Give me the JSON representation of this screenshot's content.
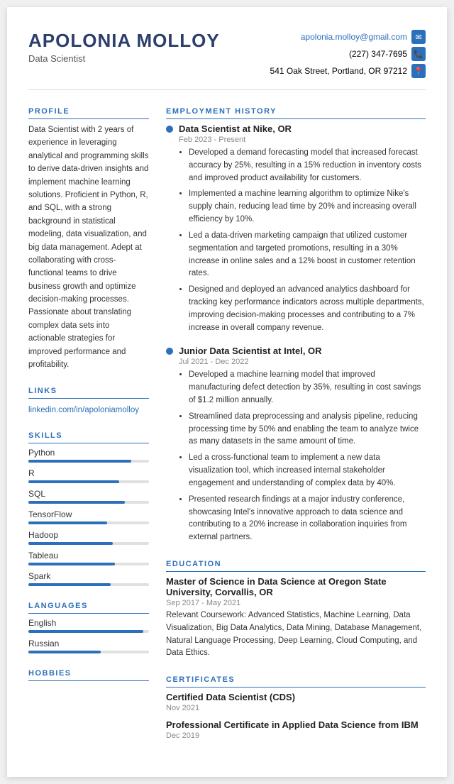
{
  "header": {
    "name": "APOLONIA MOLLOY",
    "title": "Data Scientist",
    "email": "apolonia.molloy@gmail.com",
    "phone": "(227) 347-7695",
    "address": "541 Oak Street, Portland, OR 97212"
  },
  "left": {
    "profile_title": "PROFILE",
    "profile_text": "Data Scientist with 2 years of experience in leveraging analytical and programming skills to derive data-driven insights and implement machine learning solutions. Proficient in Python, R, and SQL, with a strong background in statistical modeling, data visualization, and big data management. Adept at collaborating with cross-functional teams to drive business growth and optimize decision-making processes. Passionate about translating complex data sets into actionable strategies for improved performance and profitability.",
    "links_title": "LINKS",
    "linkedin": "linkedin.com/in/apoloniamolloy",
    "linkedin_href": "https://linkedin.com/in/apoloniamolloy",
    "skills_title": "SKILLS",
    "skills": [
      {
        "name": "Python",
        "pct": 85
      },
      {
        "name": "R",
        "pct": 75
      },
      {
        "name": "SQL",
        "pct": 80
      },
      {
        "name": "TensorFlow",
        "pct": 65
      },
      {
        "name": "Hadoop",
        "pct": 70
      },
      {
        "name": "Tableau",
        "pct": 72
      },
      {
        "name": "Spark",
        "pct": 68
      }
    ],
    "languages_title": "LANGUAGES",
    "languages": [
      {
        "name": "English",
        "pct": 95
      },
      {
        "name": "Russian",
        "pct": 60
      }
    ],
    "hobbies_title": "HOBBIES"
  },
  "right": {
    "employment_title": "EMPLOYMENT HISTORY",
    "jobs": [
      {
        "title": "Data Scientist at Nike, OR",
        "dates": "Feb 2023 - Present",
        "bullets": [
          "Developed a demand forecasting model that increased forecast accuracy by 25%, resulting in a 15% reduction in inventory costs and improved product availability for customers.",
          "Implemented a machine learning algorithm to optimize Nike's supply chain, reducing lead time by 20% and increasing overall efficiency by 10%.",
          "Led a data-driven marketing campaign that utilized customer segmentation and targeted promotions, resulting in a 30% increase in online sales and a 12% boost in customer retention rates.",
          "Designed and deployed an advanced analytics dashboard for tracking key performance indicators across multiple departments, improving decision-making processes and contributing to a 7% increase in overall company revenue."
        ]
      },
      {
        "title": "Junior Data Scientist at Intel, OR",
        "dates": "Jul 2021 - Dec 2022",
        "bullets": [
          "Developed a machine learning model that improved manufacturing defect detection by 35%, resulting in cost savings of $1.2 million annually.",
          "Streamlined data preprocessing and analysis pipeline, reducing processing time by 50% and enabling the team to analyze twice as many datasets in the same amount of time.",
          "Led a cross-functional team to implement a new data visualization tool, which increased internal stakeholder engagement and understanding of complex data by 40%.",
          "Presented research findings at a major industry conference, showcasing Intel's innovative approach to data science and contributing to a 20% increase in collaboration inquiries from external partners."
        ]
      }
    ],
    "education_title": "EDUCATION",
    "education": [
      {
        "title": "Master of Science in Data Science at Oregon State University, Corvallis, OR",
        "dates": "Sep 2017 - May 2021",
        "text": "Relevant Coursework: Advanced Statistics, Machine Learning, Data Visualization, Big Data Analytics, Data Mining, Database Management, Natural Language Processing, Deep Learning, Cloud Computing, and Data Ethics."
      }
    ],
    "certificates_title": "CERTIFICATES",
    "certificates": [
      {
        "title": "Certified Data Scientist (CDS)",
        "date": "Nov 2021"
      },
      {
        "title": "Professional Certificate in Applied Data Science from IBM",
        "date": "Dec 2019"
      }
    ]
  }
}
